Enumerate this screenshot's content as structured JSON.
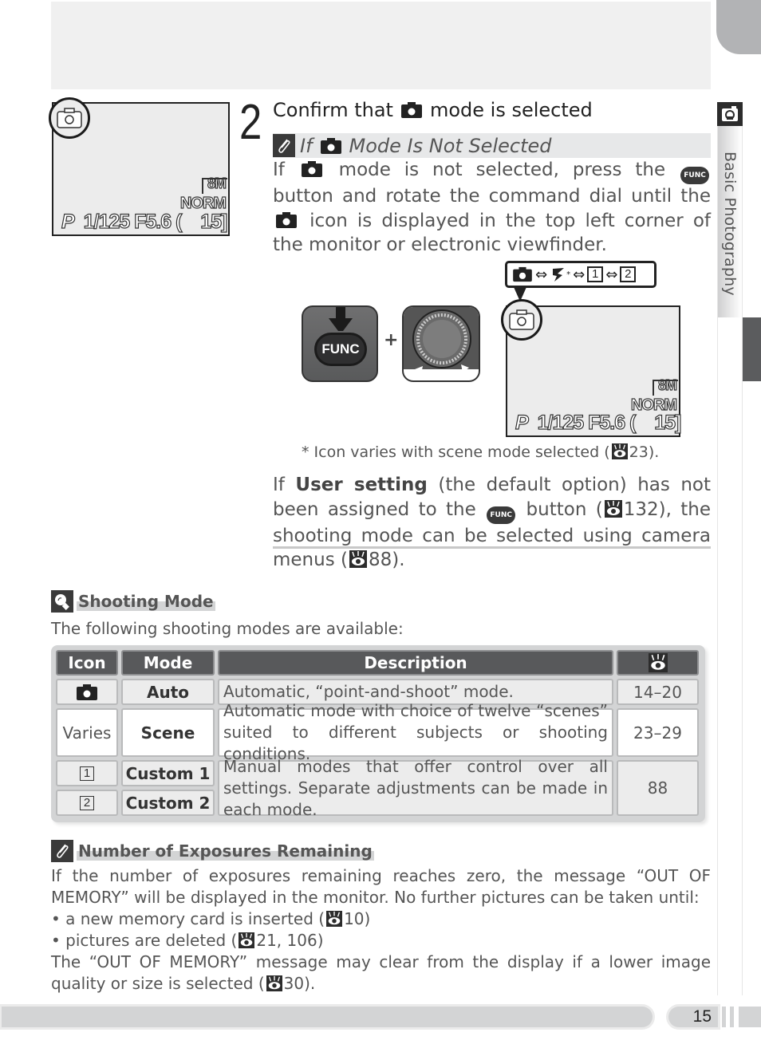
{
  "side_tab": {
    "label": "Basic Photography",
    "icon": "camera-mode-icon"
  },
  "monitor": {
    "mode": "P",
    "shutter": "1/125",
    "aperture": "F5.6",
    "bracket": "(",
    "exposures": "15]",
    "quality": "NORM",
    "size": "8M"
  },
  "step": {
    "number": "2",
    "title_before": "Confirm that",
    "title_after": "mode is selected"
  },
  "tip": {
    "title_if": "If",
    "title_rest": "Mode Is Not Selected",
    "p1_a": "If",
    "p1_b": "mode is not selected, press the",
    "p1_c": "button and rotate the command dial until the",
    "p1_d": "icon is displayed in the top left corner of the monitor or electronic viewfinder.",
    "func_label": "FUNC",
    "plus": "+",
    "footnote": "* Icon varies with scene mode selected (",
    "footnote_ref": "23).",
    "p2_a": "If",
    "p2_bold": "User setting",
    "p2_b": "(the default option) has not been assigned to the",
    "p2_c": "button (",
    "p2_d": "132), the shooting mode can be selected using camera menus (",
    "p2_e": "88)."
  },
  "mode_cycle": {
    "arrow": "⇔",
    "asterisk": "*",
    "custom1": "1",
    "custom2": "2"
  },
  "shooting_mode": {
    "title": "Shooting Mode",
    "intro": "The following shooting modes are available:",
    "headers": [
      "Icon",
      "Mode",
      "Description",
      "page-reference-icon"
    ],
    "rows": [
      {
        "icon": "camera-icon",
        "mode": "Auto",
        "description": "Automatic, “point-and-shoot” mode.",
        "pages": "14–20"
      },
      {
        "icon": "Varies",
        "mode": "Scene",
        "description": "Automatic mode with choice of twelve “scenes” suited to different subjects or shooting conditions.",
        "pages": "23–29"
      },
      {
        "icon": "1",
        "mode": "Custom 1",
        "description": "Manual modes that offer control over all settings. Separate adjustments can be made in each mode.",
        "pages": "88"
      },
      {
        "icon": "2",
        "mode": "Custom 2",
        "description": "",
        "pages": ""
      }
    ]
  },
  "exposures": {
    "title": "Number of Exposures Remaining",
    "p1": "If the number of exposures remaining reaches zero, the message “OUT OF MEMORY” will be displayed in the monitor.  No further pictures can be taken until:",
    "bullet1_a": "• a new memory card is inserted (",
    "bullet1_b": "10)",
    "bullet2_a": "• pictures are deleted (",
    "bullet2_b": "21, 106)",
    "p2_a": "The “OUT OF MEMORY” message may clear from the display if a lower image quality or size is selected (",
    "p2_b": "30)."
  },
  "footer": {
    "page_number": "15"
  },
  "colors": {
    "dark": "#3a3a3a",
    "header": "#58595b",
    "table_bg": "#d3d4d5",
    "text": "#555555"
  }
}
